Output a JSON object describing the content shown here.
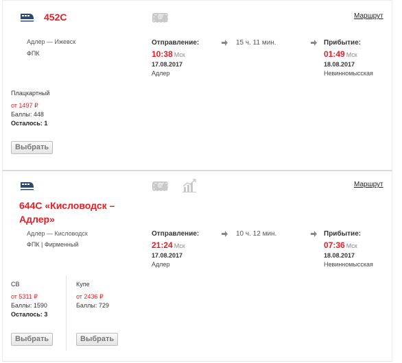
{
  "trains": [
    {
      "number": "452С",
      "title": "",
      "route": "Адлер — Ижевск",
      "carrier": "ФПК",
      "eticket_icon": "at-sign-ticket-icon",
      "route_link": "Маршрут",
      "departure": {
        "label": "Отправление:",
        "time": "10:38",
        "tz": "Мск",
        "date": "17.08.2017",
        "station": "Адлер"
      },
      "duration": "15 ч. 11 мин.",
      "arrival": {
        "label": "Прибытие:",
        "time": "01:49",
        "tz": "Мск",
        "date": "18.08.2017",
        "station": "Невинномысская"
      },
      "cars": [
        {
          "type": "Плацкартный",
          "price": "от 1497 ₽",
          "points": "Баллы: 448",
          "seats_left": "Осталось: 1",
          "button": "Выбрать"
        }
      ]
    },
    {
      "number": "",
      "title": "644С «Кисловодск – Адлер»",
      "route": "Адлер — Кисловодск",
      "carrier": "ФПК | Фирменный",
      "eticket_icon": "at-sign-ticket-icon",
      "stats_icon": "dynamic-pricing-chart-icon",
      "route_link": "Маршрут",
      "departure": {
        "label": "Отправление:",
        "time": "21:24",
        "tz": "Мск",
        "date": "17.08.2017",
        "station": "Адлер"
      },
      "duration": "10 ч. 12 мин.",
      "arrival": {
        "label": "Прибытие:",
        "time": "07:36",
        "tz": "Мск",
        "date": "18.08.2017",
        "station": "Невинномысская"
      },
      "cars": [
        {
          "type": "СВ",
          "price": "от 5311 ₽",
          "points": "Баллы: 1590",
          "seats_left": "Осталось: 3",
          "button": "Выбрать"
        },
        {
          "type": "Купе",
          "price": "от 2436 ₽",
          "points": "Баллы: 729",
          "seats_left": "",
          "button": "Выбрать"
        }
      ]
    }
  ],
  "colors": {
    "accent": "#e31e24",
    "icon": "#2d4a6b",
    "muted": "#c9c9c9"
  }
}
